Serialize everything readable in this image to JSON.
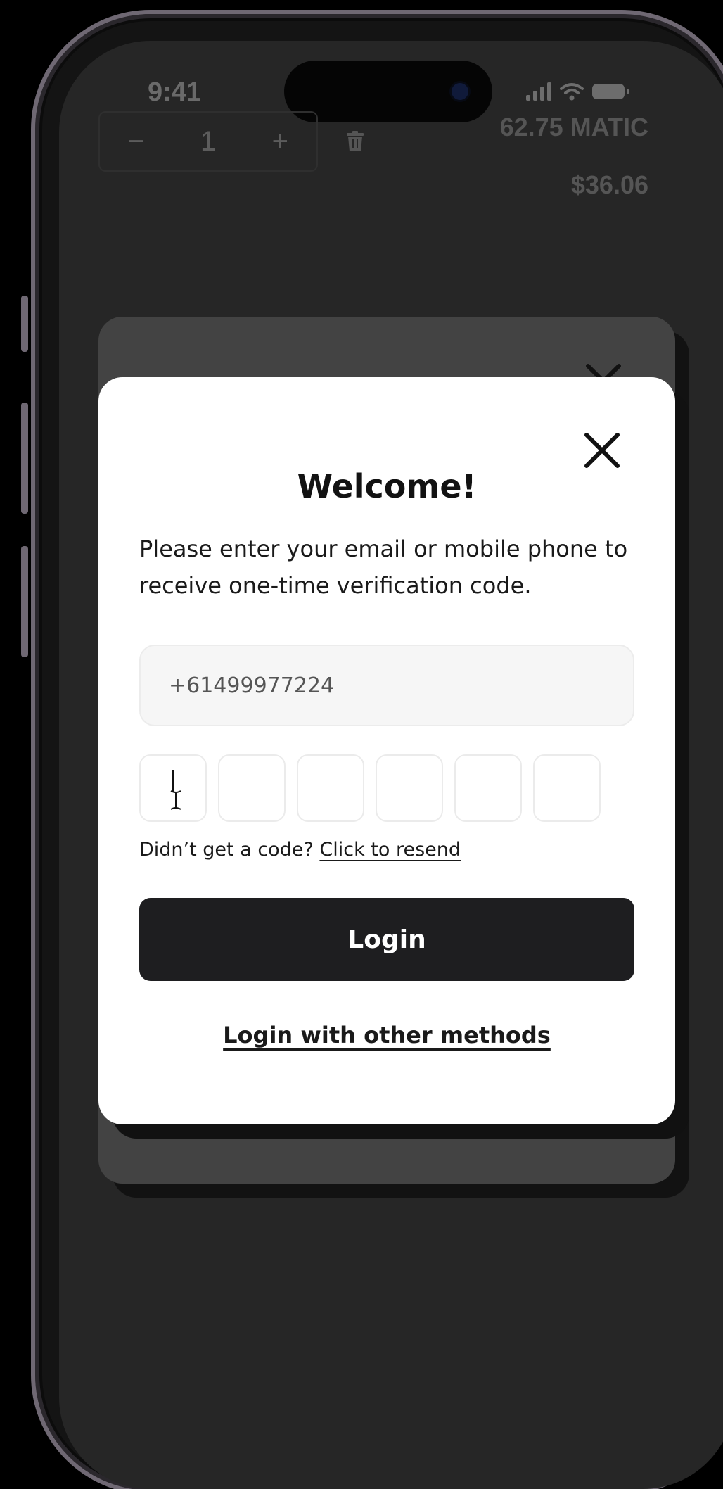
{
  "status_bar": {
    "time": "9:41"
  },
  "cart": {
    "quantity_minus": "−",
    "quantity_value": "1",
    "quantity_plus": "+",
    "price_matic": "62.75 MATIC",
    "price_usd": "$36.06"
  },
  "modal": {
    "title": "Welcome!",
    "description": "Please enter your email or mobile phone to receive one-time verification code.",
    "phone_value": "+61499977224",
    "otp_digits": [
      "",
      "",
      "",
      "",
      "",
      ""
    ],
    "resend_prompt": "Didn’t get a code?",
    "resend_link": "Click to resend",
    "login_label": "Login",
    "other_methods_label": "Login with other methods"
  },
  "colors": {
    "screen_bg": "#262626",
    "modal_bg": "#ffffff",
    "button_bg": "#1e1e20",
    "frame": "#6f6873"
  },
  "icons": [
    "close-icon",
    "trash-icon",
    "signal-icon",
    "wifi-icon",
    "battery-icon",
    "text-cursor-icon"
  ]
}
